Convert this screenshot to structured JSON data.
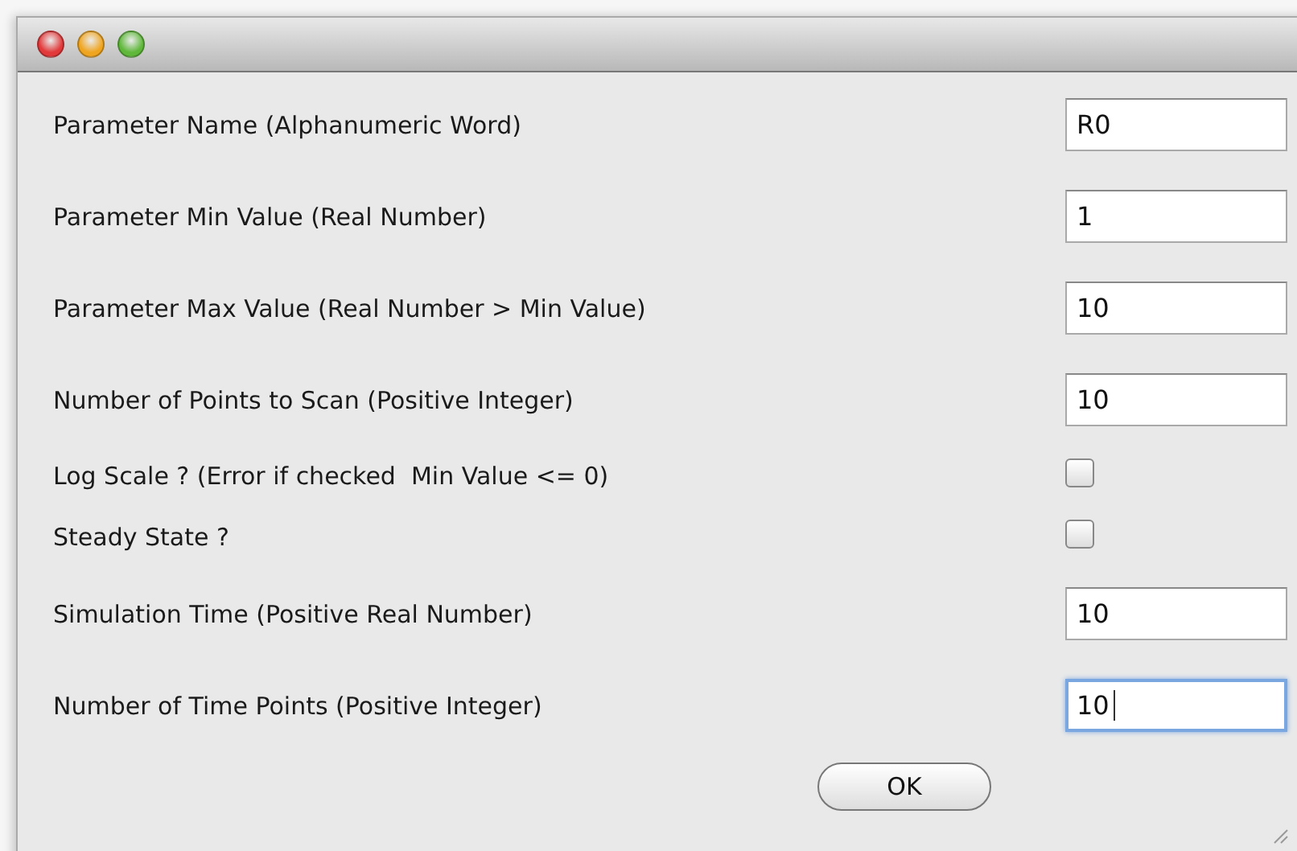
{
  "window": {
    "buttons": [
      {
        "kind": "close"
      },
      {
        "kind": "minimize"
      },
      {
        "kind": "zoom"
      }
    ]
  },
  "rows": [
    {
      "kind": "text",
      "label": "Parameter Name (Alphanumeric Word)",
      "value": "R0",
      "focused": false
    },
    {
      "kind": "text",
      "label": "Parameter Min Value (Real Number)",
      "value": "1",
      "focused": false
    },
    {
      "kind": "text",
      "label": "Parameter Max Value (Real Number > Min Value)",
      "value": "10",
      "focused": false
    },
    {
      "kind": "text",
      "label": "Number of Points to Scan (Positive Integer)",
      "value": "10",
      "focused": false
    },
    {
      "kind": "checkbox",
      "label": "Log Scale ? (Error if checked  Min Value <= 0)",
      "checked": false
    },
    {
      "kind": "checkbox",
      "label": "Steady State ?",
      "checked": false
    },
    {
      "kind": "text",
      "label": "Simulation Time (Positive Real Number)",
      "value": "10",
      "focused": false
    },
    {
      "kind": "text",
      "label": "Number of Time Points (Positive Integer)",
      "value": "10",
      "focused": true
    }
  ],
  "ok_button": "OK"
}
